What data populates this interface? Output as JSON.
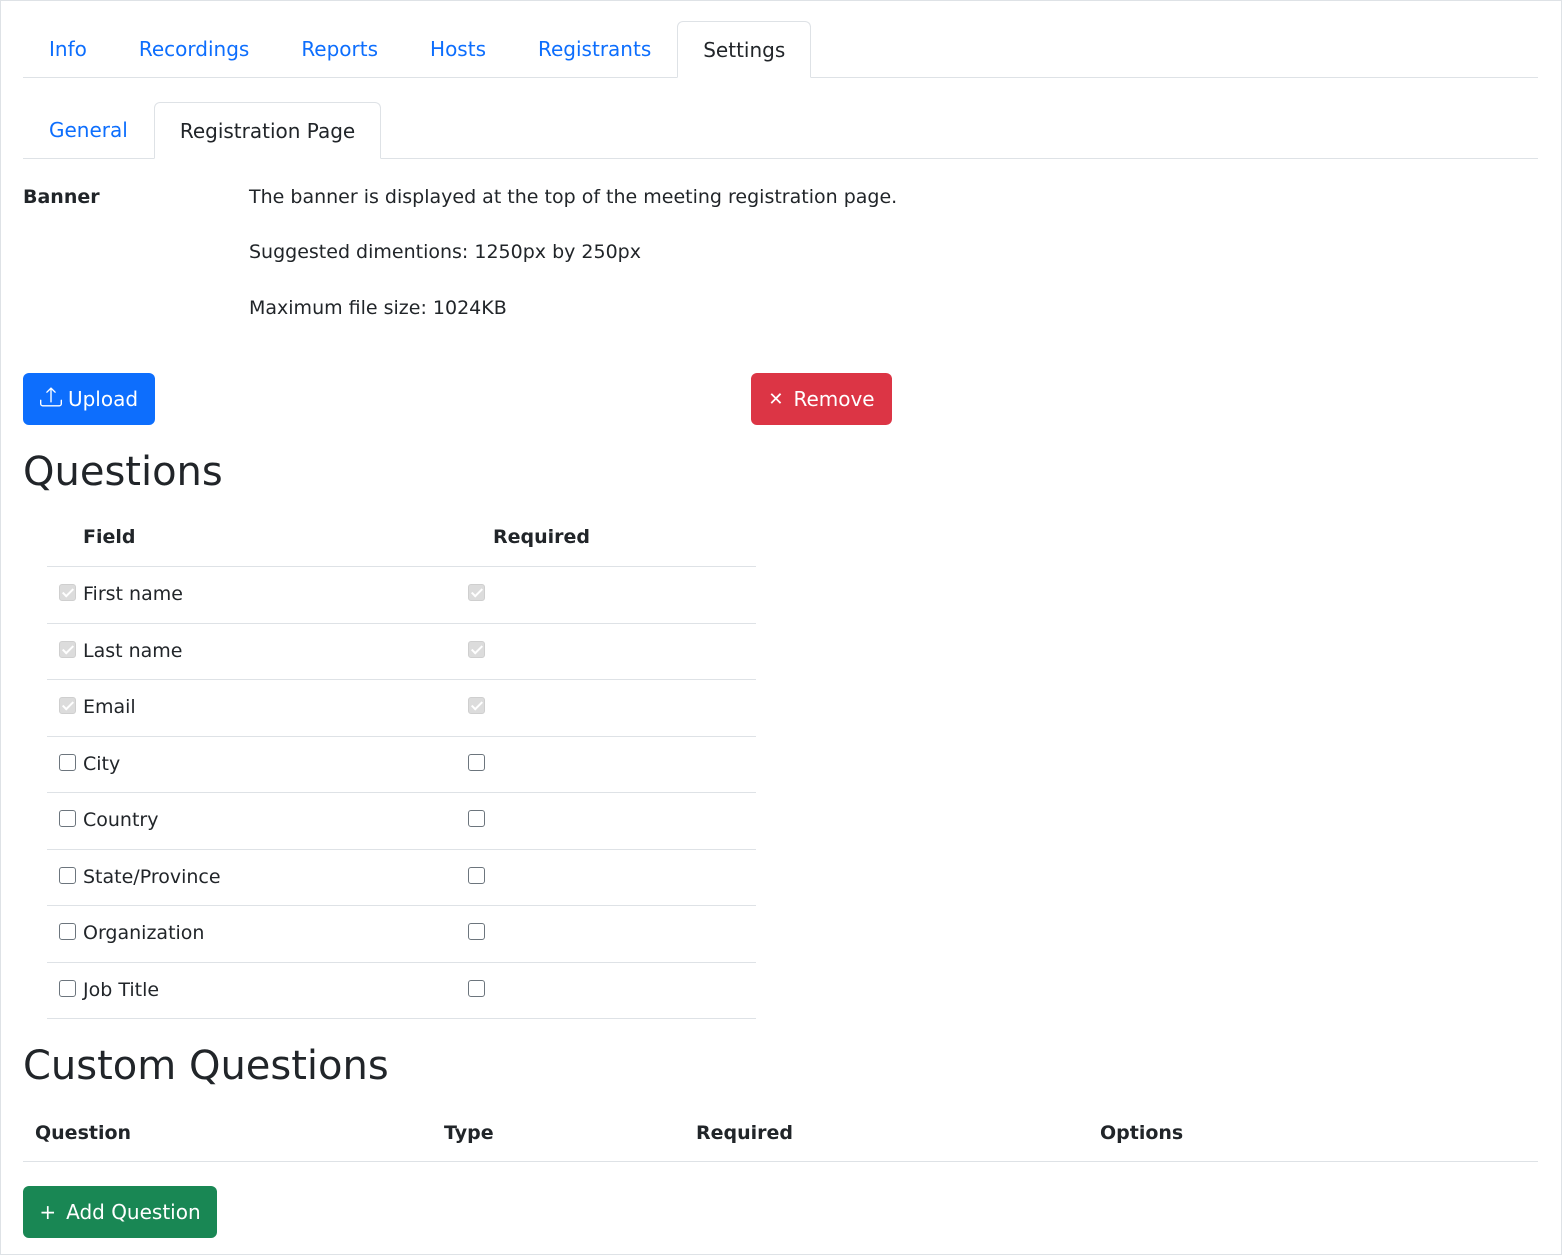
{
  "tabs": {
    "top": [
      {
        "label": "Info"
      },
      {
        "label": "Recordings"
      },
      {
        "label": "Reports"
      },
      {
        "label": "Hosts"
      },
      {
        "label": "Registrants"
      },
      {
        "label": "Settings",
        "active": true
      }
    ],
    "sub": [
      {
        "label": "General"
      },
      {
        "label": "Registration Page",
        "active": true
      }
    ]
  },
  "banner": {
    "label": "Banner",
    "description": "The banner is displayed at the top of the meeting registration page.",
    "dimensions": "Suggested dimentions: 1250px by 250px",
    "max_size": "Maximum file size: 1024KB",
    "upload_label": "Upload",
    "upload_icon": "upload-icon",
    "remove_label": "Remove",
    "remove_icon": "close-icon"
  },
  "questions": {
    "title": "Questions",
    "headers": {
      "field": "Field",
      "required": "Required"
    },
    "rows": [
      {
        "field": "First name",
        "enabled": true,
        "required": true,
        "disabled": true
      },
      {
        "field": "Last name",
        "enabled": true,
        "required": true,
        "disabled": true
      },
      {
        "field": "Email",
        "enabled": true,
        "required": true,
        "disabled": true
      },
      {
        "field": "City",
        "enabled": false,
        "required": false,
        "disabled": false
      },
      {
        "field": "Country",
        "enabled": false,
        "required": false,
        "disabled": false
      },
      {
        "field": "State/Province",
        "enabled": false,
        "required": false,
        "disabled": false
      },
      {
        "field": "Organization",
        "enabled": false,
        "required": false,
        "disabled": false
      },
      {
        "field": "Job Title",
        "enabled": false,
        "required": false,
        "disabled": false
      }
    ]
  },
  "custom_questions": {
    "title": "Custom Questions",
    "headers": {
      "question": "Question",
      "type": "Type",
      "required": "Required",
      "options": "Options"
    },
    "add_label": "Add Question",
    "add_icon": "plus-icon"
  },
  "colors": {
    "primary": "#0d6efd",
    "danger": "#dc3545",
    "success": "#198754"
  }
}
